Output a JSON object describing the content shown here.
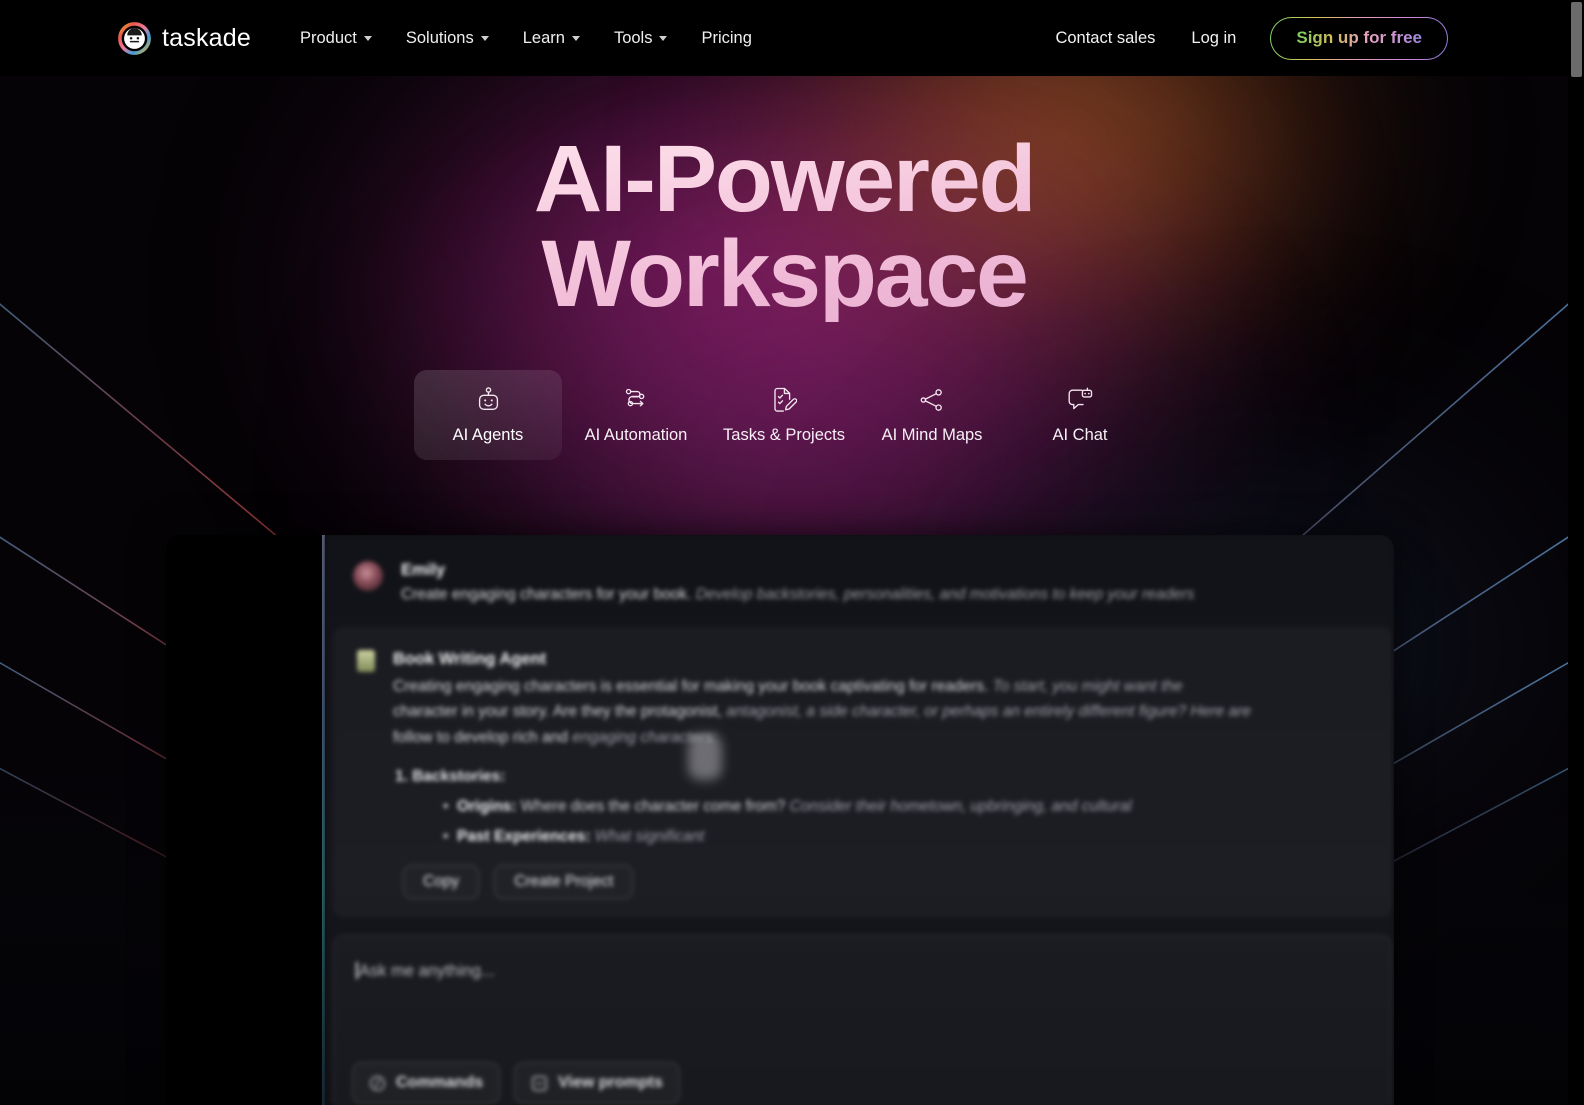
{
  "brand": {
    "name": "taskade",
    "logo_icon": "taskade-circle-face-logo"
  },
  "nav": {
    "links": [
      {
        "label": "Product",
        "has_caret": true
      },
      {
        "label": "Solutions",
        "has_caret": true
      },
      {
        "label": "Learn",
        "has_caret": true
      },
      {
        "label": "Tools",
        "has_caret": true
      },
      {
        "label": "Pricing",
        "has_caret": false
      }
    ],
    "contact_sales": "Contact sales",
    "log_in": "Log in",
    "sign_up": "Sign up for free"
  },
  "hero": {
    "title_line1": "AI-Powered",
    "title_line2": "Workspace",
    "tabs": [
      {
        "label": "AI Agents",
        "icon": "robot-icon",
        "active": true
      },
      {
        "label": "AI Automation",
        "icon": "automation-flow-icon",
        "active": false
      },
      {
        "label": "Tasks & Projects",
        "icon": "document-check-pencil-icon",
        "active": false
      },
      {
        "label": "AI Mind Maps",
        "icon": "share-nodes-icon",
        "active": false
      },
      {
        "label": "AI Chat",
        "icon": "chat-robot-icon",
        "active": false
      }
    ]
  },
  "app_preview": {
    "user": {
      "name": "Emily",
      "message": "Create engaging characters for your book.",
      "message_faded": "Develop backstories, personalities, and motivations to keep your readers"
    },
    "agent": {
      "name": "Book Writing Agent",
      "paragraph_line1": "Creating engaging characters is essential for making your book captivating for readers.",
      "paragraph_line1_faded": "To start, you might want the",
      "paragraph_line2": "character in your story. Are they the protagonist,",
      "paragraph_line2_faded": "antagonist, a side character, or perhaps an entirely different figure? Here are",
      "paragraph_line3": "follow to develop rich and",
      "paragraph_line3_faded": "engaging characters:",
      "list_item_1": "1. Backstories:",
      "bullet_1_label": "Origins:",
      "bullet_1_text": "Where does the character come from?",
      "bullet_1_faded": "Consider their hometown, upbringing, and cultural",
      "bullet_2_label": "Past Experiences:",
      "bullet_2_faded": "What significant",
      "buttons": [
        "Copy",
        "Create Project"
      ]
    },
    "composer": {
      "placeholder": "Ask me anything...",
      "buttons": [
        {
          "label": "Commands",
          "icon": "slash-command-icon"
        },
        {
          "label": "View prompts",
          "icon": "prompt-list-icon"
        }
      ]
    }
  },
  "colors": {
    "page_background": "#000000",
    "hero_glow_magenta": "#aa2882",
    "hero_glow_orange": "#d7782d",
    "title_gradient_start": "#fdf0f5",
    "title_gradient_end": "#e2a5cf",
    "signup_gradient": "#76cf63,#cdbe55,#e7a3bb,#cf96d6,#9a86e2"
  }
}
